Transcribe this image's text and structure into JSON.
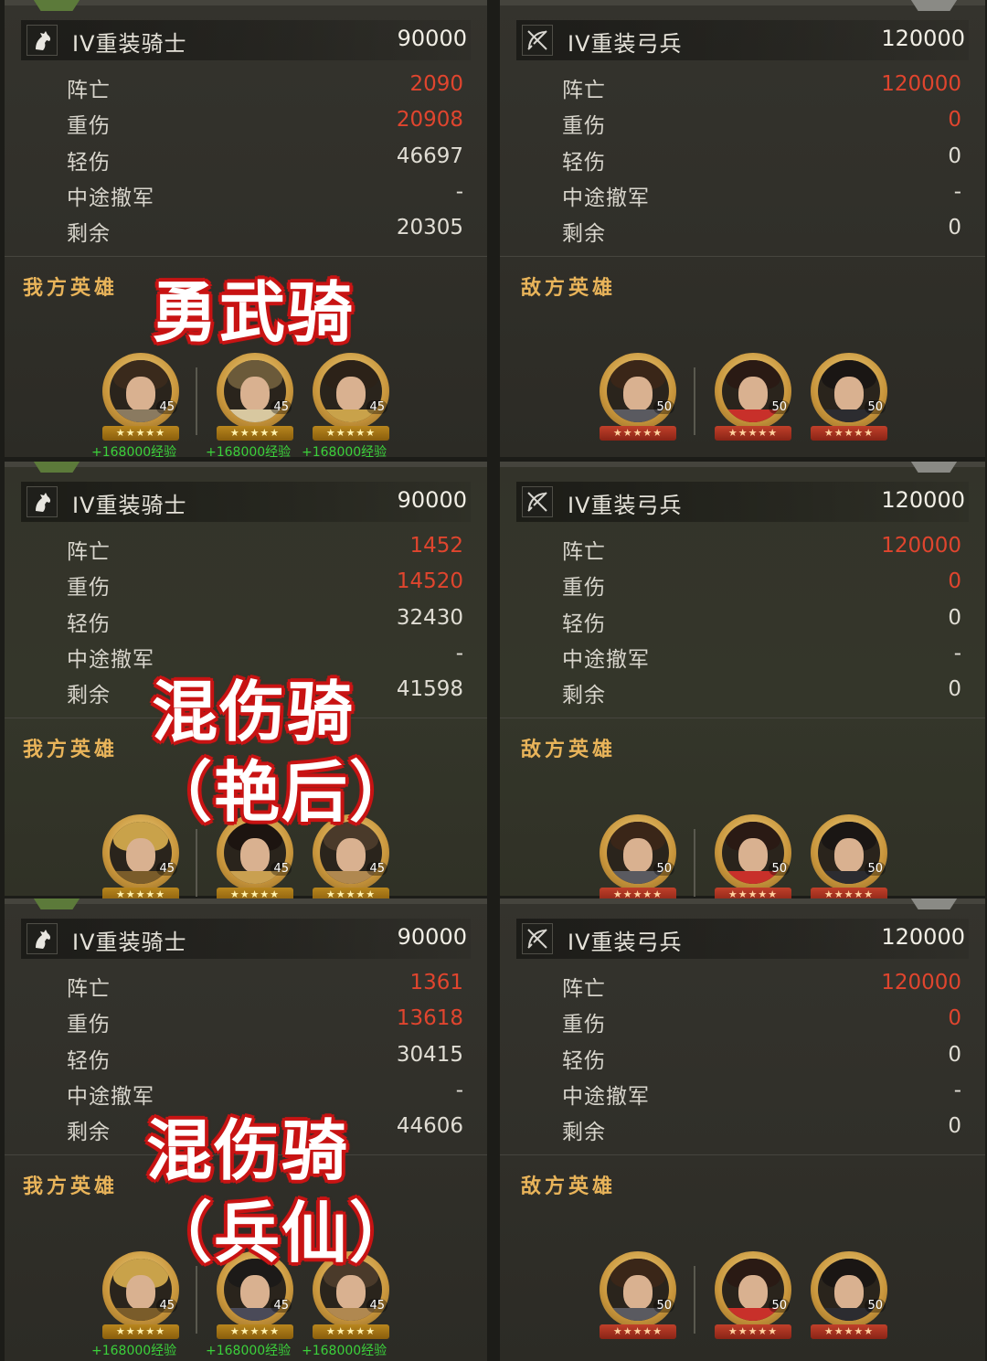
{
  "colors": {
    "loss_red": "#e0452e",
    "hero_label": "#e9b45a",
    "exp_green": "#3bd13b",
    "overlay_red": "#c81414"
  },
  "sections": [
    {
      "overlay": [
        "勇武骑"
      ],
      "left": {
        "icon": "horse-icon",
        "unit": "IV重装骑士",
        "total": "90000",
        "rows": [
          {
            "label": "阵亡",
            "value": "2090",
            "red": true
          },
          {
            "label": "重伤",
            "value": "20908",
            "red": true
          },
          {
            "label": "轻伤",
            "value": "46697",
            "red": false
          },
          {
            "label": "中途撤军",
            "value": "-",
            "red": false
          },
          {
            "label": "剩余",
            "value": "20305",
            "red": false
          }
        ],
        "hero_label": "我方英雄",
        "heroes": [
          {
            "level": "45",
            "exp": "+168000经验"
          },
          {
            "level": "45",
            "exp": "+168000经验"
          },
          {
            "level": "45",
            "exp": "+168000经验"
          }
        ]
      },
      "right": {
        "icon": "bow-icon",
        "unit": "IV重装弓兵",
        "total": "120000",
        "rows": [
          {
            "label": "阵亡",
            "value": "120000",
            "red": true
          },
          {
            "label": "重伤",
            "value": "0",
            "red": true
          },
          {
            "label": "轻伤",
            "value": "0",
            "red": false
          },
          {
            "label": "中途撤军",
            "value": "-",
            "red": false
          },
          {
            "label": "剩余",
            "value": "0",
            "red": false
          }
        ],
        "hero_label": "敌方英雄",
        "heroes": [
          {
            "level": "50"
          },
          {
            "level": "50"
          },
          {
            "level": "50"
          }
        ]
      }
    },
    {
      "overlay": [
        "混伤骑",
        "（艳后）"
      ],
      "left": {
        "icon": "horse-icon",
        "unit": "IV重装骑士",
        "total": "90000",
        "rows": [
          {
            "label": "阵亡",
            "value": "1452",
            "red": true
          },
          {
            "label": "重伤",
            "value": "14520",
            "red": true
          },
          {
            "label": "轻伤",
            "value": "32430",
            "red": false
          },
          {
            "label": "中途撤军",
            "value": "-",
            "red": false
          },
          {
            "label": "剩余",
            "value": "41598",
            "red": false
          }
        ],
        "hero_label": "我方英雄",
        "heroes": [
          {
            "level": "45"
          },
          {
            "level": "45"
          },
          {
            "level": "45"
          }
        ]
      },
      "right": {
        "icon": "bow-icon",
        "unit": "IV重装弓兵",
        "total": "120000",
        "rows": [
          {
            "label": "阵亡",
            "value": "120000",
            "red": true
          },
          {
            "label": "重伤",
            "value": "0",
            "red": true
          },
          {
            "label": "轻伤",
            "value": "0",
            "red": false
          },
          {
            "label": "中途撤军",
            "value": "-",
            "red": false
          },
          {
            "label": "剩余",
            "value": "0",
            "red": false
          }
        ],
        "hero_label": "敌方英雄",
        "heroes": [
          {
            "level": "50"
          },
          {
            "level": "50"
          },
          {
            "level": "50"
          }
        ]
      }
    },
    {
      "overlay": [
        "混伤骑",
        "（兵仙）"
      ],
      "left": {
        "icon": "horse-icon",
        "unit": "IV重装骑士",
        "total": "90000",
        "rows": [
          {
            "label": "阵亡",
            "value": "1361",
            "red": true
          },
          {
            "label": "重伤",
            "value": "13618",
            "red": true
          },
          {
            "label": "轻伤",
            "value": "30415",
            "red": false
          },
          {
            "label": "中途撤军",
            "value": "-",
            "red": false
          },
          {
            "label": "剩余",
            "value": "44606",
            "red": false
          }
        ],
        "hero_label": "我方英雄",
        "heroes": [
          {
            "level": "45",
            "exp": "+168000经验"
          },
          {
            "level": "45",
            "exp": "+168000经验"
          },
          {
            "level": "45",
            "exp": "+168000经验"
          }
        ]
      },
      "right": {
        "icon": "bow-icon",
        "unit": "IV重装弓兵",
        "total": "120000",
        "rows": [
          {
            "label": "阵亡",
            "value": "120000",
            "red": true
          },
          {
            "label": "重伤",
            "value": "0",
            "red": true
          },
          {
            "label": "轻伤",
            "value": "0",
            "red": false
          },
          {
            "label": "中途撤军",
            "value": "-",
            "red": false
          },
          {
            "label": "剩余",
            "value": "0",
            "red": false
          }
        ],
        "hero_label": "敌方英雄",
        "heroes": [
          {
            "level": "50"
          },
          {
            "level": "50"
          },
          {
            "level": "50"
          }
        ]
      }
    }
  ]
}
